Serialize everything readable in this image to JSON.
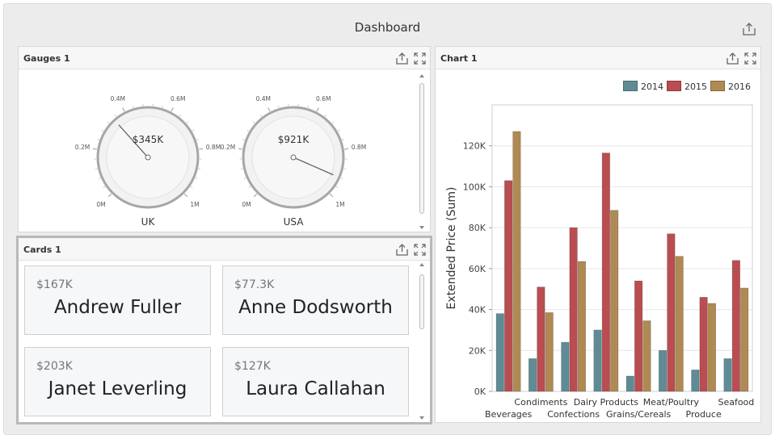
{
  "dashboard": {
    "title": "Dashboard"
  },
  "gauges_panel": {
    "title": "Gauges 1",
    "gauges": [
      {
        "label": "UK",
        "value_text": "$345K",
        "value": 345000
      },
      {
        "label": "USA",
        "value_text": "$921K",
        "value": 921000
      }
    ],
    "scale": {
      "min": 0,
      "max": 1000000,
      "ticks": [
        "0M",
        "0.2M",
        "0.4M",
        "0.6M",
        "0.8M",
        "1M"
      ]
    }
  },
  "cards_panel": {
    "title": "Cards 1",
    "cards": [
      {
        "value": "$167K",
        "name": "Andrew Fuller"
      },
      {
        "value": "$77.3K",
        "name": "Anne Dodsworth"
      },
      {
        "value": "$203K",
        "name": "Janet Leverling"
      },
      {
        "value": "$127K",
        "name": "Laura Callahan"
      }
    ]
  },
  "chart_panel": {
    "title": "Chart 1"
  },
  "chart_data": {
    "type": "bar",
    "title": "",
    "xlabel": "",
    "ylabel": "Extended Price (Sum)",
    "ylim": [
      0,
      140000
    ],
    "yticks": [
      0,
      20000,
      40000,
      60000,
      80000,
      100000,
      120000
    ],
    "ytick_labels": [
      "0K",
      "20K",
      "40K",
      "60K",
      "80K",
      "100K",
      "120K"
    ],
    "categories": [
      "Beverages",
      "Condiments",
      "Confections",
      "Dairy Products",
      "Grains/Cereals",
      "Meat/Poultry",
      "Produce",
      "Seafood"
    ],
    "series": [
      {
        "name": "2014",
        "color": "#5f8b95",
        "values": [
          38000,
          16000,
          24000,
          30000,
          7500,
          20000,
          10500,
          16000
        ]
      },
      {
        "name": "2015",
        "color": "#ba4d51",
        "values": [
          103000,
          51000,
          80000,
          116500,
          54000,
          77000,
          46000,
          64000
        ]
      },
      {
        "name": "2016",
        "color": "#af8a53",
        "values": [
          127000,
          38500,
          63500,
          88500,
          34500,
          66000,
          43000,
          50500
        ]
      }
    ],
    "legend_position": "top-right",
    "grid": true
  },
  "colors": {
    "gauge_ring": "#a6a6a6",
    "gauge_face": "#f2f2f2",
    "needle": "#555555"
  }
}
